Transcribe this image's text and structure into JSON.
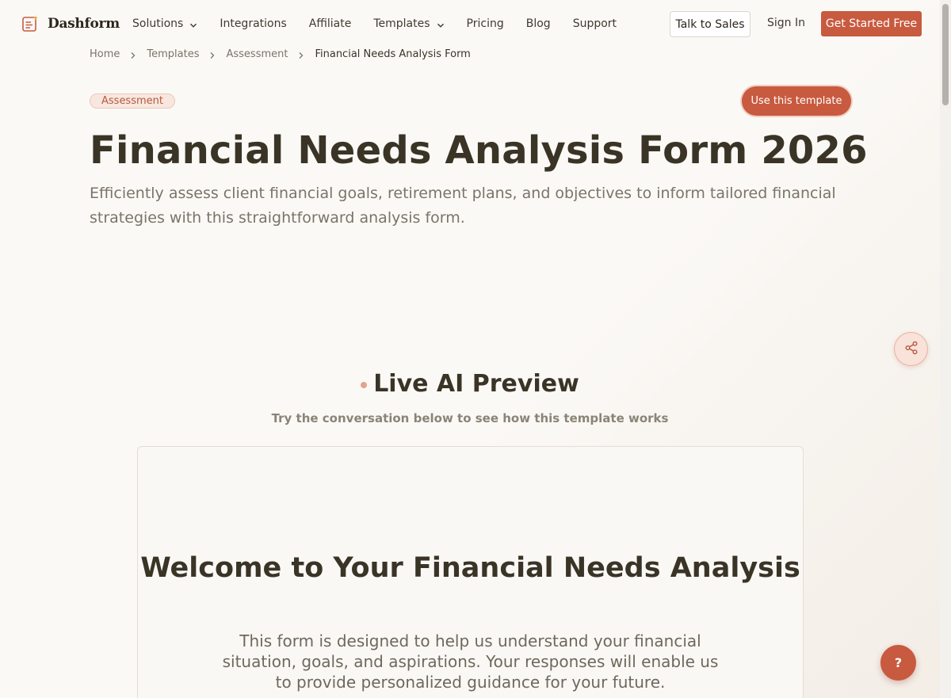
{
  "brand": {
    "name": "Dashform"
  },
  "nav": {
    "links": [
      {
        "label": "Solutions",
        "has_dropdown": true
      },
      {
        "label": "Integrations",
        "has_dropdown": false
      },
      {
        "label": "Affiliate",
        "has_dropdown": false
      },
      {
        "label": "Templates",
        "has_dropdown": true
      },
      {
        "label": "Pricing",
        "has_dropdown": false
      },
      {
        "label": "Blog",
        "has_dropdown": false
      },
      {
        "label": "Support",
        "has_dropdown": false
      }
    ],
    "talk_to_sales": "Talk to Sales",
    "sign_in": "Sign In",
    "get_started": "Get Started Free"
  },
  "breadcrumb": {
    "items": [
      "Home",
      "Templates",
      "Assessment"
    ],
    "current": "Financial Needs Analysis Form"
  },
  "hero": {
    "badge": "Assessment",
    "use_template": "Use this template",
    "title": "Financial Needs Analysis Form 2026",
    "description": "Efficiently assess client financial goals, retirement plans, and objectives to inform tailored financial strategies with this straightforward analysis form."
  },
  "preview": {
    "title": "Live AI Preview",
    "subtitle": "Try the conversation below to see how this template works",
    "welcome_title": "Welcome to Your Financial Needs Analysis",
    "welcome_desc": "This form is designed to help us understand your financial situation, goals, and aspirations. Your responses will enable us to provide personalized guidance for your future."
  },
  "help": {
    "label": "?"
  },
  "colors": {
    "accent": "#c85a3f",
    "text": "#3a3427",
    "muted": "#7a7468",
    "badge_bg": "#f8e7df"
  },
  "icons": {
    "logo": "form-sparkle-icon",
    "dropdown": "chevron-down-icon",
    "breadcrumb_sep": "chevron-right-icon",
    "share": "share-icon"
  }
}
